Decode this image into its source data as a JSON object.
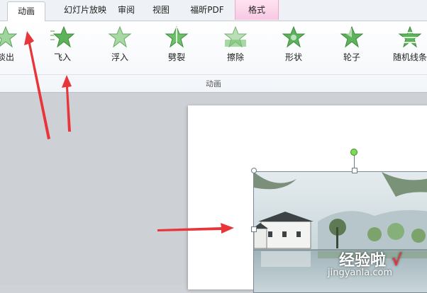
{
  "tabs": [
    {
      "label": "动画"
    },
    {
      "label": "幻灯片放映"
    },
    {
      "label": "审阅"
    },
    {
      "label": "视图"
    },
    {
      "label": "福昕PDF"
    },
    {
      "label": "格式"
    }
  ],
  "ribbon": {
    "group_label": "动画",
    "effects": [
      {
        "label": "淡出",
        "icon": "star-fade-icon"
      },
      {
        "label": "飞入",
        "icon": "star-fly-in-icon"
      },
      {
        "label": "浮入",
        "icon": "star-float-in-icon"
      },
      {
        "label": "劈裂",
        "icon": "star-split-icon"
      },
      {
        "label": "擦除",
        "icon": "star-wipe-icon"
      },
      {
        "label": "形状",
        "icon": "star-shape-icon"
      },
      {
        "label": "轮子",
        "icon": "star-wheel-icon"
      },
      {
        "label": "随机线条",
        "icon": "star-random-bars-icon"
      }
    ]
  },
  "watermark": {
    "text": "经验啦",
    "check": "√",
    "url": "jingyanla.com"
  },
  "colors": {
    "accent_red": "#e8353a",
    "star_green": "#4da84f",
    "format_tab": "#f7c9e2"
  }
}
